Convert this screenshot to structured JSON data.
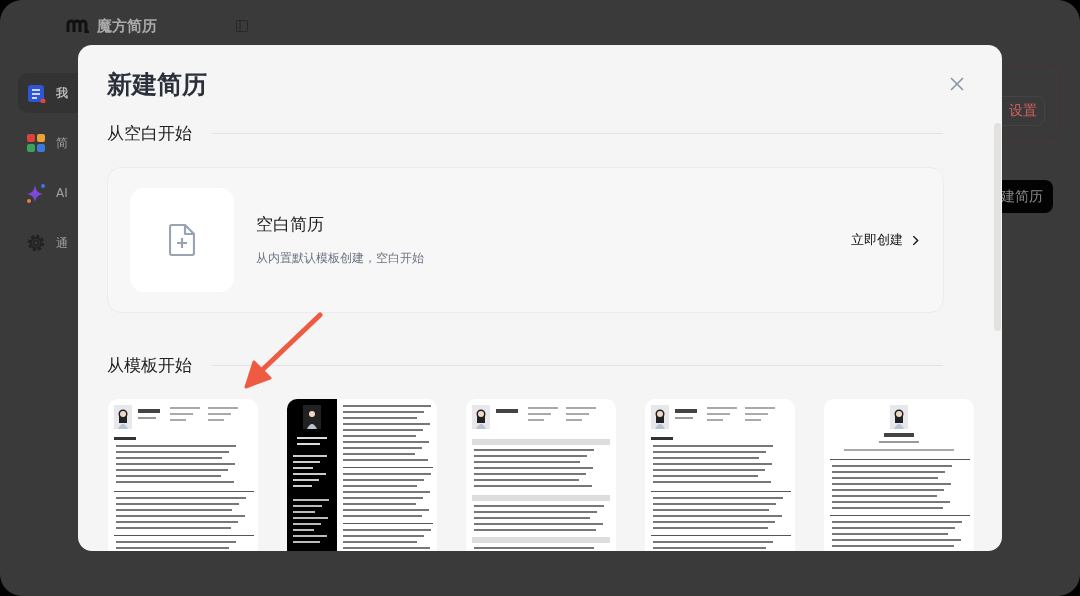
{
  "app": {
    "logo_text": "魔方简历",
    "sidebar": {
      "items": [
        {
          "label": "我",
          "kind": "resume",
          "selected": true
        },
        {
          "label": "简",
          "kind": "grid",
          "selected": false
        },
        {
          "label": "AI",
          "kind": "sparkle",
          "selected": false
        },
        {
          "label": "通",
          "kind": "gear",
          "selected": false
        }
      ]
    },
    "settings_button": "设置",
    "new_button": "建简历"
  },
  "dialog": {
    "title": "新建简历",
    "blank_section": {
      "heading": "从空白开始",
      "card_title": "空白简历",
      "card_subtitle": "从内置默认模板创建，空白开始",
      "action": "立即创建"
    },
    "template_section": {
      "heading": "从模板开始"
    }
  }
}
